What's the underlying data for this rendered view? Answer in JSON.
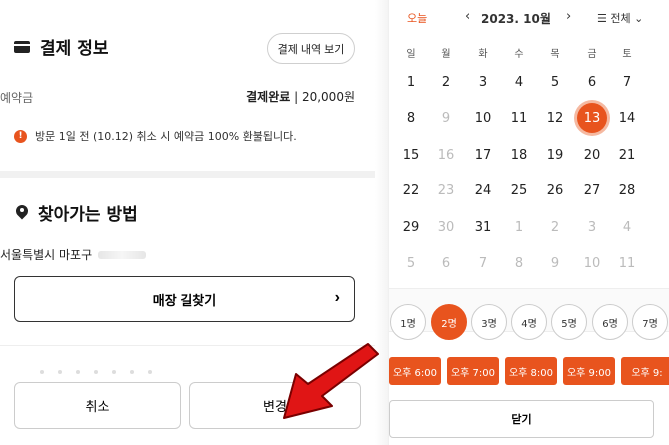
{
  "payment": {
    "title": "결제 정보",
    "history_button": "결제 내역 보기",
    "deposit_label": "예약금",
    "deposit_status": "결제완료",
    "deposit_amount": "| 20,000원",
    "notice": "방문 1일 전 (10.12) 취소 시 예약금 100% 환불됩니다."
  },
  "directions": {
    "title": "찾아가는 방법",
    "address": "서울특별시 마포구",
    "find_button": "매장 길찾기"
  },
  "actions": {
    "cancel": "취소",
    "change": "변경"
  },
  "calendar": {
    "today_label": "오늘",
    "month_label": "2023. 10월",
    "filter_label": "전체",
    "weekdays": [
      "일",
      "월",
      "화",
      "수",
      "목",
      "금",
      "토"
    ],
    "weeks": [
      [
        "1",
        "2",
        "3",
        "4",
        "5",
        "6",
        "7"
      ],
      [
        "8",
        "9",
        "10",
        "11",
        "12",
        "13",
        "14"
      ],
      [
        "15",
        "16",
        "17",
        "18",
        "19",
        "20",
        "21"
      ],
      [
        "22",
        "23",
        "24",
        "25",
        "26",
        "27",
        "28"
      ],
      [
        "29",
        "30",
        "31",
        "1",
        "2",
        "3",
        "4"
      ],
      [
        "5",
        "6",
        "7",
        "8",
        "9",
        "10",
        "11"
      ]
    ],
    "selected_date": "13"
  },
  "party_size": {
    "options": [
      "1명",
      "2명",
      "3명",
      "4명",
      "5명",
      "6명",
      "7명"
    ],
    "selected": "2명"
  },
  "times": [
    "오후 6:00",
    "오후 7:00",
    "오후 8:00",
    "오후 9:00",
    "오후 9:"
  ],
  "close_button": "닫기",
  "colors": {
    "accent": "#e8541e",
    "text": "#222222",
    "disabled": "#bbbbbb"
  }
}
